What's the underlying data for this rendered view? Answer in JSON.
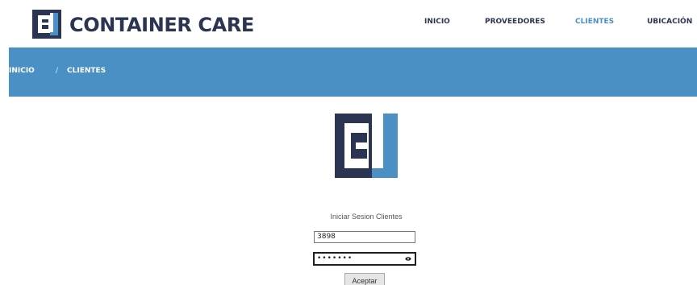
{
  "brand": {
    "name": "CONTAINER CARE",
    "dark_color": "#2b3452",
    "accent_color": "#4a90c4"
  },
  "nav": {
    "items": [
      {
        "label": "INICIO",
        "active": false
      },
      {
        "label": "PROVEEDORES",
        "active": false
      },
      {
        "label": "CLIENTES",
        "active": true
      },
      {
        "label": "UBICACIÓN",
        "active": false
      }
    ]
  },
  "breadcrumb": {
    "home": "INICIO",
    "separator": "/",
    "current": "CLIENTES"
  },
  "login": {
    "title": "Iniciar Sesion Clientes",
    "user_value": "3898",
    "password_mask": "•••••••",
    "reveal_icon": "eye-icon",
    "submit_label": "Aceptar"
  }
}
